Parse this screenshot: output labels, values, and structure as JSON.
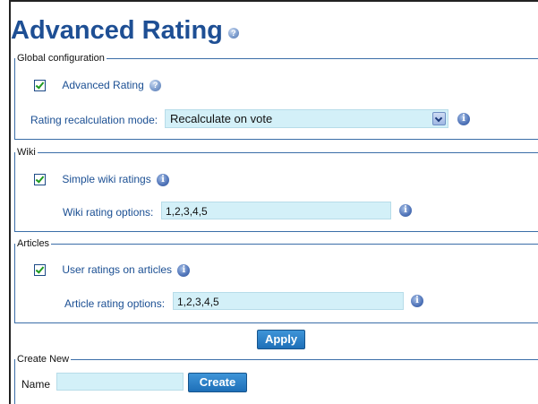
{
  "page": {
    "title": "Advanced Rating"
  },
  "global": {
    "legend": "Global configuration",
    "advanced_rating_label": "Advanced Rating",
    "advanced_rating_checked": true,
    "recalc_label": "Rating recalculation mode:",
    "recalc_value": "Recalculate on vote"
  },
  "wiki": {
    "legend": "Wiki",
    "simple_ratings_label": "Simple wiki ratings",
    "simple_ratings_checked": true,
    "options_label": "Wiki rating options:",
    "options_value": "1,2,3,4,5"
  },
  "articles": {
    "legend": "Articles",
    "user_ratings_label": "User ratings on articles",
    "user_ratings_checked": true,
    "options_label": "Article rating options:",
    "options_value": "1,2,3,4,5"
  },
  "actions": {
    "apply_label": "Apply"
  },
  "create_new": {
    "legend": "Create New",
    "name_label": "Name",
    "name_value": "",
    "create_label": "Create"
  },
  "icons": {
    "help": "help-icon",
    "info": "info-icon"
  },
  "colors": {
    "title": "#1e4f94",
    "label": "#1b4f93",
    "input_bg": "#d3f0f8",
    "button_bg": "#2b80c8",
    "border": "#3b6ea8"
  }
}
